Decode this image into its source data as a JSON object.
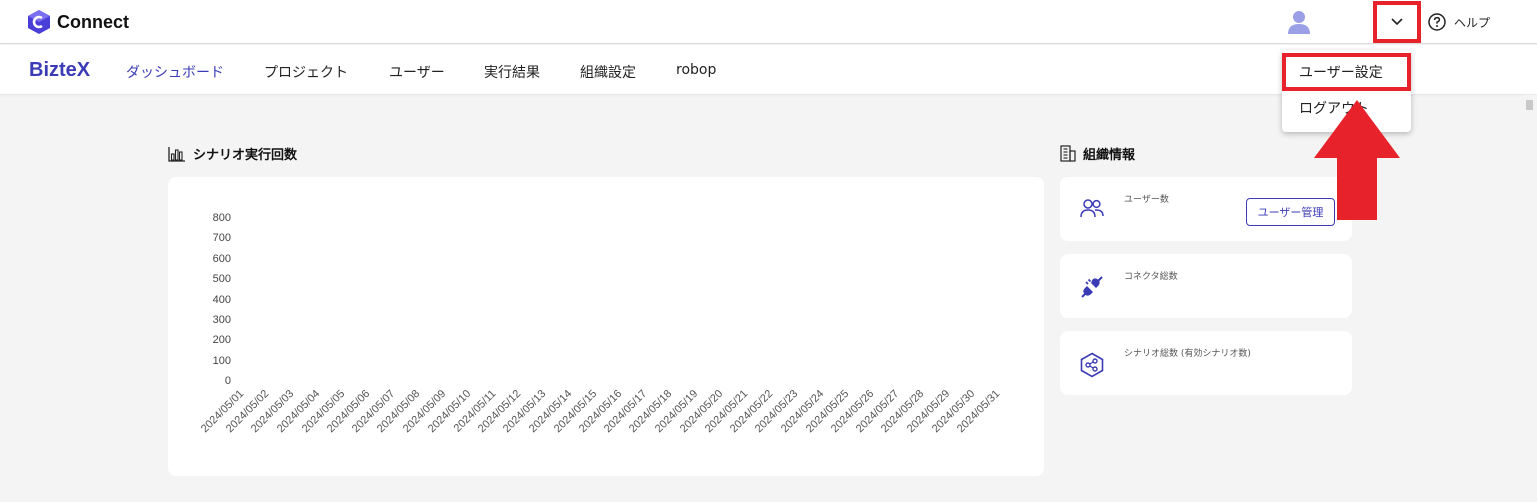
{
  "app": {
    "logo_text": "Connect",
    "help_label": "ヘルプ"
  },
  "nav": {
    "brand": "BizteX",
    "items": [
      "ダッシュボード",
      "プロジェクト",
      "ユーザー",
      "実行結果",
      "組織設定",
      "robop"
    ]
  },
  "user_menu": {
    "items": [
      "ユーザー設定",
      "ログアウト"
    ]
  },
  "chart_section": {
    "title": "シナリオ実行回数"
  },
  "chart_data": {
    "type": "bar",
    "categories": [
      "2024/05/01",
      "2024/05/02",
      "2024/05/03",
      "2024/05/04",
      "2024/05/05",
      "2024/05/06",
      "2024/05/07",
      "2024/05/08",
      "2024/05/09",
      "2024/05/10",
      "2024/05/11",
      "2024/05/12",
      "2024/05/13",
      "2024/05/14",
      "2024/05/15",
      "2024/05/16",
      "2024/05/17",
      "2024/05/18",
      "2024/05/19",
      "2024/05/20",
      "2024/05/21",
      "2024/05/22",
      "2024/05/23",
      "2024/05/24",
      "2024/05/25",
      "2024/05/26",
      "2024/05/27",
      "2024/05/28",
      "2024/05/29",
      "2024/05/30",
      "2024/05/31"
    ],
    "values": [
      0,
      0,
      0,
      0,
      0,
      0,
      0,
      0,
      0,
      0,
      0,
      0,
      0,
      0,
      0,
      0,
      0,
      0,
      0,
      0,
      0,
      0,
      0,
      0,
      0,
      0,
      0,
      0,
      0,
      0,
      0
    ],
    "yticks": [
      800,
      700,
      600,
      500,
      400,
      300,
      200,
      100,
      0
    ],
    "ylim": [
      0,
      800
    ],
    "grid": false,
    "legend": "none"
  },
  "org_section": {
    "title": "組織情報",
    "cards": [
      {
        "label": "ユーザー数",
        "icon": "users-icon"
      },
      {
        "label": "コネクタ総数",
        "icon": "plug-icon"
      },
      {
        "label": "シナリオ総数 (有効シナリオ数)",
        "icon": "scenario-icon"
      }
    ],
    "manage_button": "ユーザー管理"
  },
  "colors": {
    "accent": "#3b3bb5",
    "highlight": "#e8222a",
    "background": "#f4f4f4"
  }
}
